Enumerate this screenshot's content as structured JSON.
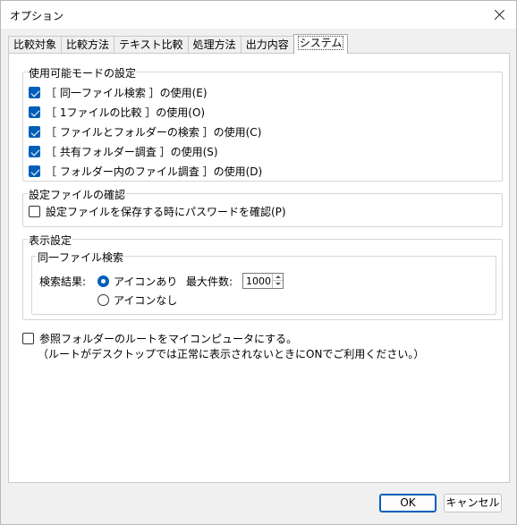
{
  "window": {
    "title": "オプション"
  },
  "tabs": [
    {
      "label": "比較対象"
    },
    {
      "label": "比較方法"
    },
    {
      "label": "テキスト比較"
    },
    {
      "label": "処理方法"
    },
    {
      "label": "出力内容"
    },
    {
      "label": "システム",
      "active": true
    }
  ],
  "modes": {
    "legend": "使用可能モードの設定",
    "items": [
      {
        "label": "［ 同一ファイル検索 ］の使用(E)",
        "checked": true
      },
      {
        "label": "［ 1ファイルの比較 ］の使用(O)",
        "checked": true
      },
      {
        "label": "［ ファイルとフォルダーの検索 ］の使用(C)",
        "checked": true
      },
      {
        "label": "［ 共有フォルダー調査 ］の使用(S)",
        "checked": true
      },
      {
        "label": "［ フォルダー内のファイル調査 ］の使用(D)",
        "checked": true
      }
    ]
  },
  "settings_file": {
    "legend": "設定ファイルの確認",
    "password_label": "設定ファイルを保存する時にパスワードを確認(P)",
    "checked": false
  },
  "display": {
    "legend": "表示設定",
    "same_file": {
      "legend": "同一ファイル検索",
      "result_label": "検索結果:",
      "radio_with_icon": "アイコンあり",
      "radio_without_icon": "アイコンなし",
      "selected": "with_icon",
      "max_label": "最大件数:",
      "max_value": "1000"
    }
  },
  "root_option": {
    "label": "参照フォルダーのルートをマイコンピュータにする。",
    "note": "（ルートがデスクトップでは正常に表示されないときにONでご利用ください。）",
    "checked": false
  },
  "buttons": {
    "ok": "OK",
    "cancel": "キャンセル"
  },
  "colors": {
    "accent": "#005fb8",
    "panel": "#ffffff",
    "dialog": "#f0f0f0"
  }
}
